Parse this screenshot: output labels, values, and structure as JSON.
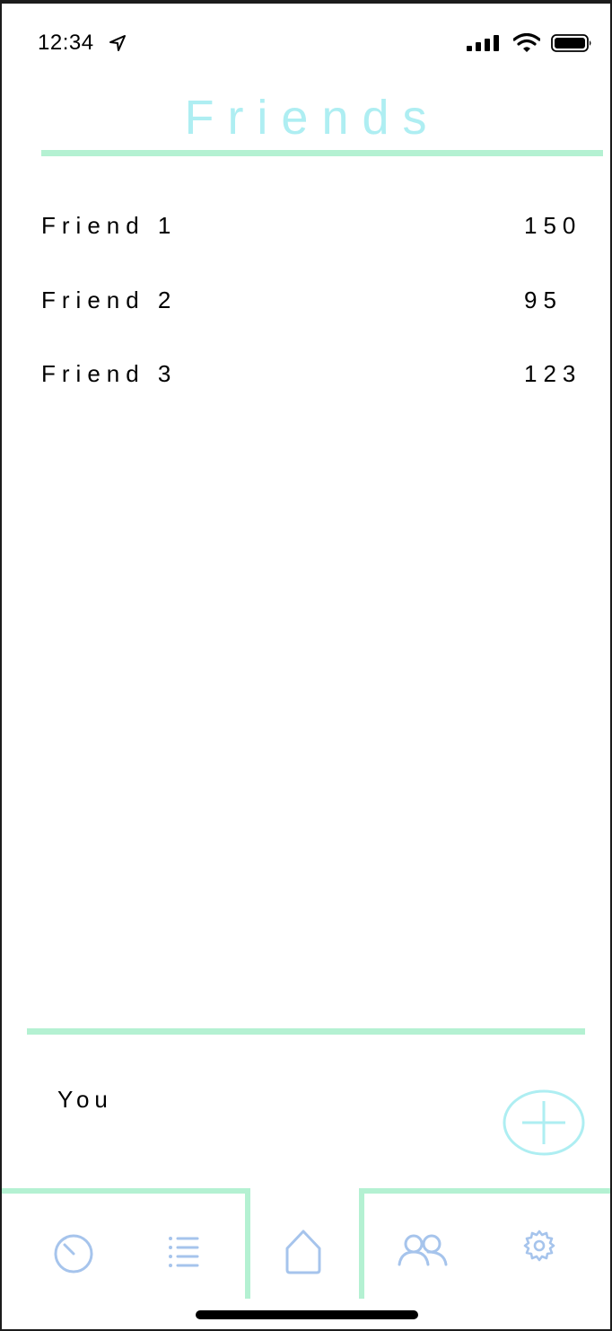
{
  "status_bar": {
    "time": "12:34",
    "icons": [
      "location-arrow-icon",
      "cellular-signal-icon",
      "wifi-icon",
      "battery-icon"
    ]
  },
  "header": {
    "title": "Friends"
  },
  "friends": [
    {
      "name": "Friend 1",
      "score": "150"
    },
    {
      "name": "Friend 2",
      "score": "95"
    },
    {
      "name": "Friend 3",
      "score": "123"
    }
  ],
  "you": {
    "label": "You"
  },
  "actions": {
    "add_icon": "plus-circle-icon"
  },
  "tab_bar": {
    "items": [
      {
        "icon": "timer-icon"
      },
      {
        "icon": "list-icon"
      },
      {
        "icon": "home-icon"
      },
      {
        "icon": "friends-icon"
      },
      {
        "icon": "settings-icon"
      }
    ]
  },
  "colors": {
    "title": "#aeeef2",
    "accent_rule": "#b4f1d2",
    "icon": "#a6c4ec"
  }
}
